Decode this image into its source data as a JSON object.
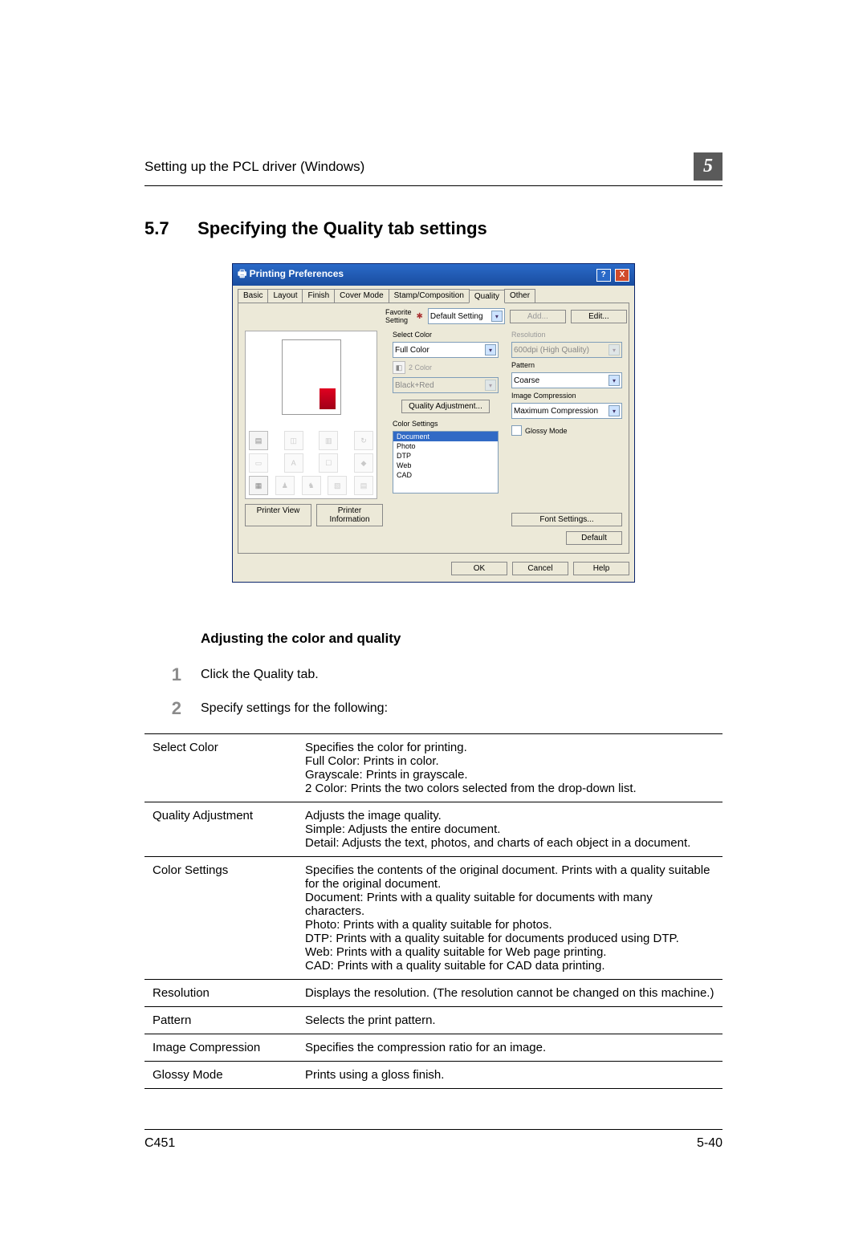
{
  "running_head": "Setting up the PCL driver (Windows)",
  "chapter_num": "5",
  "section_num": "5.7",
  "section_title": "Specifying the Quality tab settings",
  "dlg": {
    "title": "Printing Preferences",
    "tabs": [
      "Basic",
      "Layout",
      "Finish",
      "Cover Mode",
      "Stamp/Composition",
      "Quality",
      "Other"
    ],
    "active_tab": "Quality",
    "fav_label": "Favorite Setting",
    "fav_value": "Default Setting",
    "add": "Add...",
    "edit": "Edit...",
    "left": {
      "printer_view": "Printer View",
      "printer_info": "Printer Information"
    },
    "mid": {
      "select_color": "Select Color",
      "select_color_value": "Full Color",
      "two_color": "2 Color",
      "blackred": "Black+Red",
      "quality_adj": "Quality Adjustment...",
      "color_settings": "Color Settings",
      "cs_items": [
        "Document",
        "Photo",
        "DTP",
        "Web",
        "CAD"
      ]
    },
    "right": {
      "resolution_l": "Resolution",
      "resolution_v": "600dpi (High Quality)",
      "pattern_l": "Pattern",
      "pattern_v": "Coarse",
      "imgcomp_l": "Image Compression",
      "imgcomp_v": "Maximum Compression",
      "glossy": "Glossy Mode",
      "font_settings": "Font Settings..."
    },
    "default": "Default",
    "ok": "OK",
    "cancel": "Cancel",
    "help": "Help"
  },
  "sub_heading": "Adjusting the color and quality",
  "steps": {
    "s1": "Click the Quality tab.",
    "s2": "Specify settings for the following:"
  },
  "table": {
    "rows": [
      {
        "k": "Select Color",
        "v": "Specifies the color for printing.\nFull Color: Prints in color.\nGrayscale: Prints in grayscale.\n2 Color: Prints the two colors selected from the drop-down list."
      },
      {
        "k": "Quality Adjustment",
        "v": "Adjusts the image quality.\nSimple: Adjusts the entire document.\nDetail: Adjusts the text, photos, and charts of each object in a document."
      },
      {
        "k": "Color Settings",
        "v": "Specifies the contents of the original document. Prints with a quality suitable for the original document.\nDocument: Prints with a quality suitable for documents with many characters.\nPhoto: Prints with a quality suitable for photos.\nDTP: Prints with a quality suitable for documents produced using DTP.\nWeb: Prints with a quality suitable for Web page printing.\nCAD: Prints with a quality suitable for CAD data printing."
      },
      {
        "k": "Resolution",
        "v": "Displays the resolution. (The resolution cannot be changed on this machine.)"
      },
      {
        "k": "Pattern",
        "v": "Selects the print pattern."
      },
      {
        "k": "Image Compression",
        "v": "Specifies the compression ratio for an image."
      },
      {
        "k": "Glossy Mode",
        "v": "Prints using a gloss finish."
      }
    ]
  },
  "footer": {
    "left": "C451",
    "right": "5-40"
  }
}
